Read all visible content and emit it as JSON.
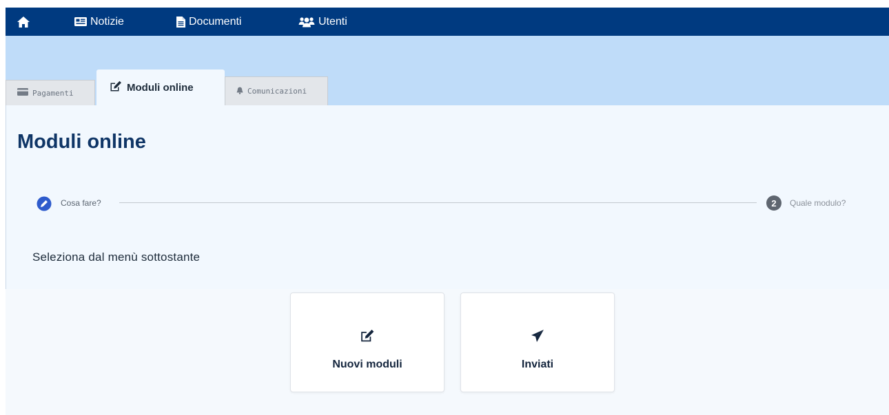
{
  "topnav": {
    "items": [
      {
        "icon": "home-icon",
        "label": ""
      },
      {
        "icon": "newspaper-icon",
        "label": "Notizie"
      },
      {
        "icon": "file-icon",
        "label": "Documenti"
      },
      {
        "icon": "users-icon",
        "label": "Utenti"
      }
    ]
  },
  "tabs": [
    {
      "icon": "credit-card-icon",
      "label": "Pagamenti",
      "active": false
    },
    {
      "icon": "edit-icon",
      "label": "Moduli online",
      "active": true
    },
    {
      "icon": "bell-icon",
      "label": "Comunicazioni",
      "active": false
    }
  ],
  "page": {
    "title": "Moduli online",
    "instruction": "Seleziona dal menù sottostante"
  },
  "stepper": {
    "steps": [
      {
        "icon": "pencil-icon",
        "label": "Cosa fare?",
        "state": "current"
      },
      {
        "number": "2",
        "label": "Quale modulo?",
        "state": "pending"
      }
    ]
  },
  "cards": [
    {
      "icon": "edit-icon",
      "label": "Nuovi moduli"
    },
    {
      "icon": "paper-plane-icon",
      "label": "Inviati"
    }
  ],
  "colors": {
    "nav_bg": "#003a80",
    "band_bg": "#bfdcf9",
    "panel_bg": "#f2f8fe",
    "title": "#0f3566",
    "step_active": "#2e5bcc",
    "step_pending": "#5f6670"
  }
}
